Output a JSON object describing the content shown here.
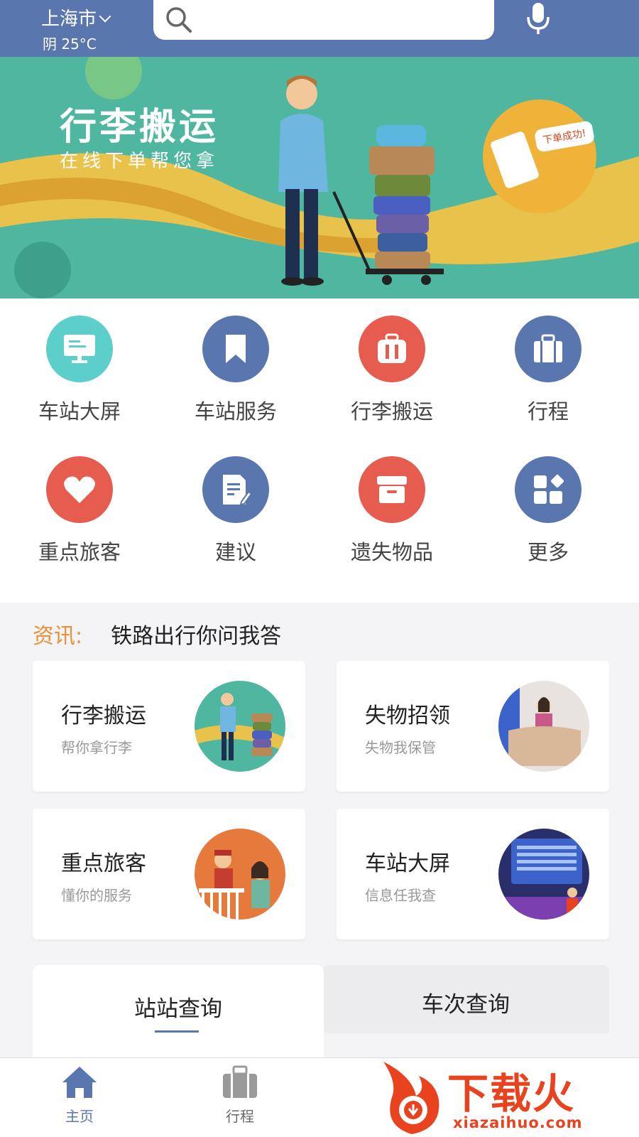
{
  "header": {
    "city": "上海市",
    "weather": "阴 25°C",
    "search_placeholder": ""
  },
  "banner": {
    "title": "行李搬运",
    "subtitle": "在线下单帮您拿",
    "bubble": "下单成功!",
    "page_count": 4,
    "active_index": 1
  },
  "grid": [
    {
      "label": "车站大屏",
      "icon": "monitor-icon",
      "color": "#5ccfcb"
    },
    {
      "label": "车站服务",
      "icon": "bookmark-icon",
      "color": "#5a76ae"
    },
    {
      "label": "行李搬运",
      "icon": "luggage-icon",
      "color": "#e65c4f"
    },
    {
      "label": "行程",
      "icon": "briefcase-icon",
      "color": "#5a76ae"
    },
    {
      "label": "重点旅客",
      "icon": "heart-icon",
      "color": "#e65c4f"
    },
    {
      "label": "建议",
      "icon": "edit-doc-icon",
      "color": "#5a76ae"
    },
    {
      "label": "遗失物品",
      "icon": "box-icon",
      "color": "#e65c4f"
    },
    {
      "label": "更多",
      "icon": "apps-icon",
      "color": "#5a76ae"
    }
  ],
  "news": {
    "tag": "资讯:",
    "text": "铁路出行你问我答"
  },
  "cards": [
    {
      "title": "行李搬运",
      "subtitle": "帮你拿行李"
    },
    {
      "title": "失物招领",
      "subtitle": "失物我保管"
    },
    {
      "title": "重点旅客",
      "subtitle": "懂你的服务"
    },
    {
      "title": "车站大屏",
      "subtitle": "信息任我查"
    }
  ],
  "query": {
    "tab_station": "站站查询",
    "tab_train": "车次查询"
  },
  "bottom_nav": {
    "home": "主页",
    "trip": "行程",
    "active_color": "#5a76ae",
    "inactive_color": "#9a9a9a"
  },
  "watermark": {
    "text": "下载火",
    "url": "xiazaihuo.com"
  }
}
